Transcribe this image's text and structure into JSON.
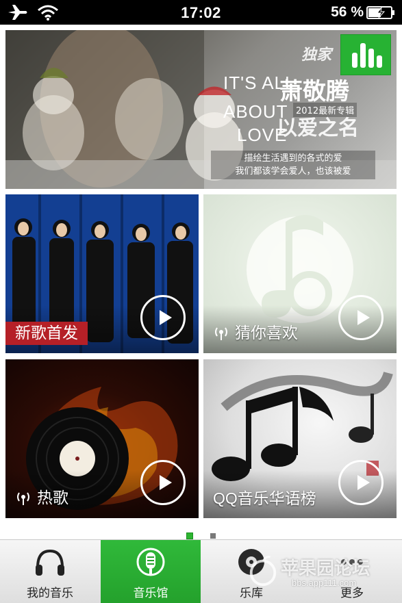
{
  "status_bar": {
    "time": "17:02",
    "battery_percent": "56 %",
    "icons": [
      "airplane-icon",
      "wifi-icon",
      "battery-charging-icon"
    ]
  },
  "banner": {
    "brand": "独家",
    "line1": "IT'S ALL",
    "line2": "ABOUT",
    "line3": "LOVE",
    "artist": "萧敬腾",
    "subtitle_tag": "2012最新专辑",
    "title_art": "以爱之名",
    "caption_line1": "描绘生活遇到的各式的爱",
    "caption_line2": "我们都该学会爱人，也该被爱",
    "chart_icon": "bar-chart-icon"
  },
  "tiles": [
    {
      "label": "新歌首发",
      "icon": "play-icon"
    },
    {
      "label": "猜你喜欢",
      "icon": "radio-icon"
    },
    {
      "label": "热歌",
      "icon": "radio-icon"
    },
    {
      "label": "QQ音乐华语榜",
      "icon": "play-icon"
    }
  ],
  "pager": {
    "pages": 2,
    "current": 1
  },
  "tab_bar": {
    "tabs": [
      {
        "label": "我的音乐",
        "icon": "headphones-icon",
        "active": false
      },
      {
        "label": "音乐馆",
        "icon": "microphone-icon",
        "active": true
      },
      {
        "label": "乐库",
        "icon": "disc-icon",
        "active": false
      },
      {
        "label": "更多",
        "icon": "more-icon",
        "active": false
      }
    ]
  },
  "watermark": {
    "text": "苹果园论坛",
    "url": "bbs.app111.com"
  },
  "colors": {
    "accent": "#27b233",
    "new_songs_red": "#b52027",
    "status_bar": "#000000"
  }
}
